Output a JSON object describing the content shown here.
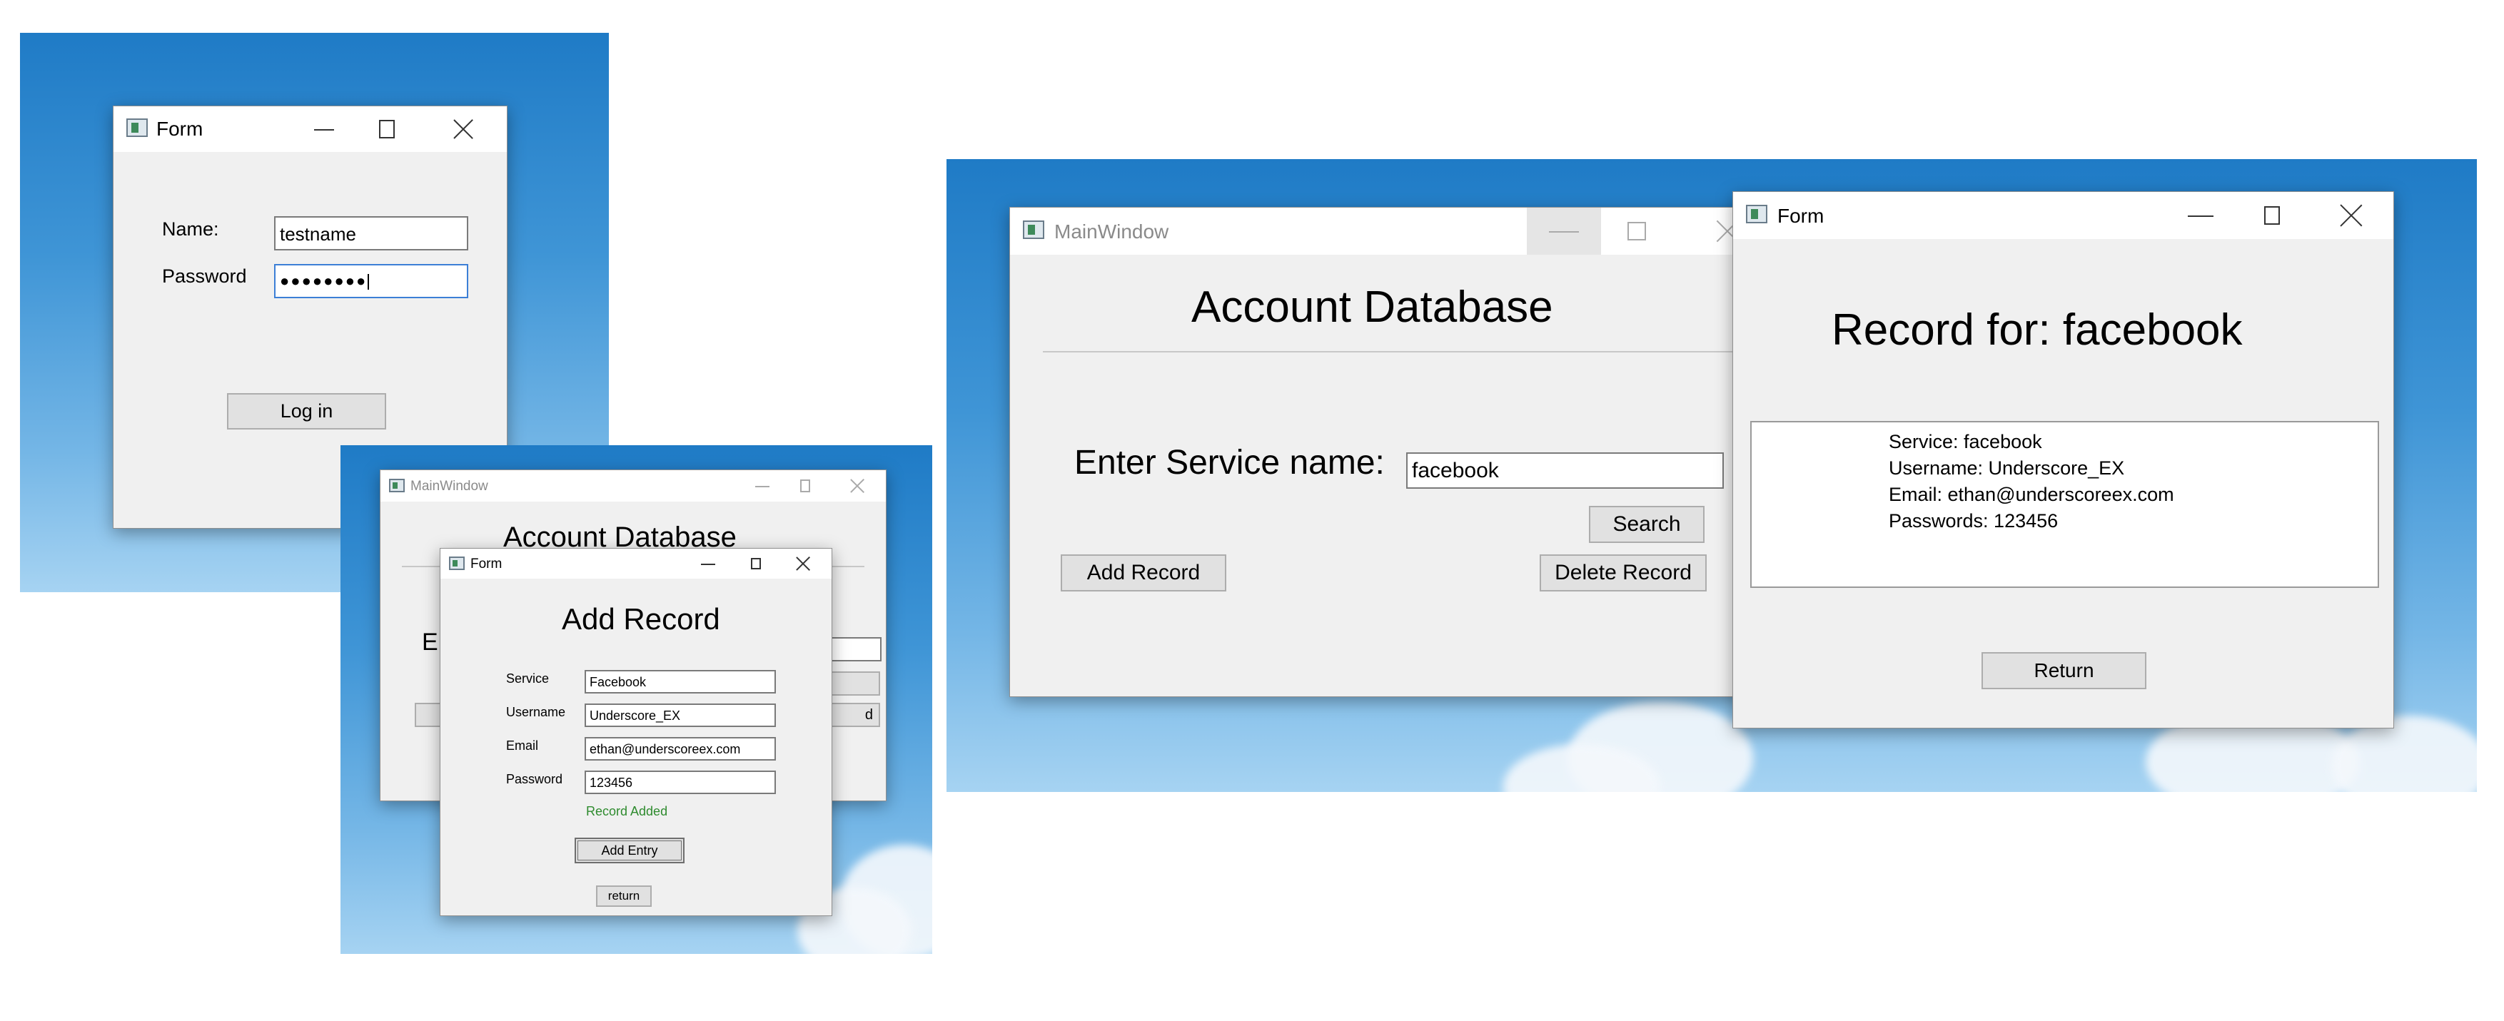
{
  "login": {
    "window_title": "Form",
    "name_label": "Name:",
    "name_value": "testname",
    "password_label": "Password",
    "password_value": "●●●●●●●●",
    "login_button": "Log in"
  },
  "add_screen": {
    "main_title": "MainWindow",
    "main_heading": "Account Database",
    "main_partial_label": "E",
    "main_partial_button": "d",
    "form_title": "Form",
    "heading": "Add Record",
    "service_label": "Service",
    "service_value": "Facebook",
    "username_label": "Username",
    "username_value": "Underscore_EX",
    "email_label": "Email",
    "email_value": "ethan@underscoreex.com",
    "password_label": "Password",
    "password_value": "123456",
    "status": "Record Added",
    "status_color": "#2e8b2e",
    "add_button": "Add Entry",
    "return_button": "return"
  },
  "search_screen": {
    "main_title": "MainWindow",
    "heading": "Account Database",
    "service_label": "Enter Service name:",
    "service_value": "facebook",
    "search_button": "Search",
    "add_button": "Add Record",
    "delete_button": "Delete Record",
    "form_title": "Form",
    "record_heading": "Record for: facebook",
    "record_lines": [
      "Service: facebook",
      "Username: Underscore_EX",
      "Email: ethan@underscoreex.com",
      "Passwords: 123456"
    ],
    "return_button": "Return"
  },
  "icons": [
    "app-window-icon",
    "minimize-icon",
    "maximize-icon",
    "close-icon"
  ]
}
